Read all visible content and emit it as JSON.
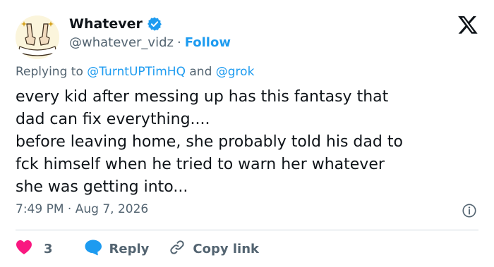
{
  "author": {
    "name": "Whatever",
    "handle": "@whatever_vidz",
    "separator": "·",
    "follow_label": "Follow",
    "avatar_icon": "hands-gesture-logo-icon",
    "verified_color": "#1d9bf0"
  },
  "brand": {
    "logo_icon": "x-logo-icon"
  },
  "reply_context": {
    "prefix": "Replying to",
    "mention_1": "@TurntUPTimHQ",
    "joiner": "and",
    "mention_2": "@grok"
  },
  "tweet": {
    "lines": [
      "every kid after messing up has this fantasy that",
      "dad can fix everything....",
      "before leaving home, she probably told his dad to",
      "fck himself when he tried to warn her whatever",
      "she was getting into..."
    ]
  },
  "meta": {
    "time": "7:49 PM",
    "separator": "·",
    "date": "Aug 7, 2026"
  },
  "actions": {
    "like_count": "3",
    "reply_label": "Reply",
    "copy_label": "Copy link"
  },
  "colors": {
    "text": "#0f1419",
    "secondary": "#536471",
    "link": "#1d9bf0",
    "like": "#f91880",
    "reply": "#1d9bf0",
    "divider": "#cfd9de"
  }
}
